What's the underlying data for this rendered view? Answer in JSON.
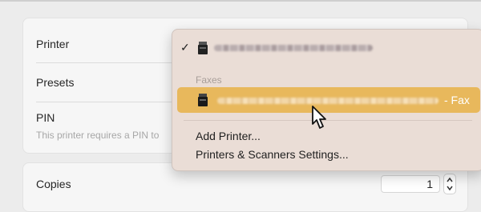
{
  "dialog": {
    "rows": {
      "printer_label": "Printer",
      "presets_label": "Presets",
      "pin_label": "PIN",
      "pin_note": "This printer requires a PIN to",
      "copies_label": "Copies",
      "copies_value": "1"
    }
  },
  "menu": {
    "faxes_header": "Faxes",
    "fax_suffix": "- Fax",
    "add_printer": "Add Printer...",
    "settings": "Printers & Scanners Settings..."
  },
  "icons": {
    "checkmark": "checkmark-icon",
    "printer": "printer-icon",
    "stepper": "stepper-icon",
    "cursor": "mouse-pointer-icon"
  },
  "colors": {
    "menu_background": "#eaddd6",
    "highlight": "#e8b85c"
  }
}
